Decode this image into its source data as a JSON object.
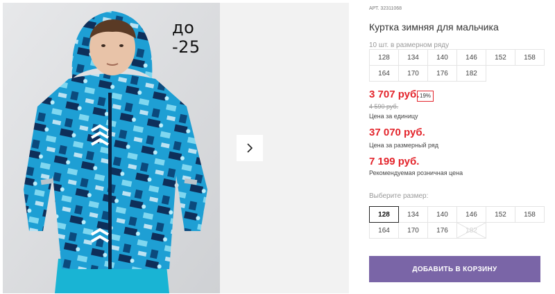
{
  "gallery": {
    "promo_badge": "до -25",
    "next_icon": "chevron-right-icon"
  },
  "product": {
    "sku_label": "АРТ.",
    "sku_value": "32311068",
    "title": "Куртка зимняя для мальчика",
    "row_note": "10 шт. в размерном ряду",
    "range_sizes": [
      "128",
      "134",
      "140",
      "146",
      "152",
      "158",
      "164",
      "170",
      "176",
      "182"
    ]
  },
  "prices": {
    "unit_price": "3 707 руб.",
    "discount": "19%",
    "old_price": "4 590 руб.",
    "unit_caption": "Цена за единицу",
    "range_price": "37 070 руб.",
    "range_caption": "Цена за размерный ряд",
    "retail_price": "7 199 руб.",
    "retail_caption": "Рекомендуемая розничная цена"
  },
  "size_picker": {
    "label": "Выберите размер:",
    "sizes": [
      {
        "label": "128",
        "state": "active"
      },
      {
        "label": "134",
        "state": "available"
      },
      {
        "label": "140",
        "state": "available"
      },
      {
        "label": "146",
        "state": "available"
      },
      {
        "label": "152",
        "state": "available"
      },
      {
        "label": "158",
        "state": "available"
      },
      {
        "label": "164",
        "state": "available"
      },
      {
        "label": "170",
        "state": "available"
      },
      {
        "label": "176",
        "state": "available"
      },
      {
        "label": "182",
        "state": "disabled"
      }
    ]
  },
  "cart": {
    "button_label": "ДОБАВИТЬ В КОРЗИНУ"
  },
  "colors": {
    "accent": "#7a65a7",
    "price_red": "#e3242b",
    "jacket_blue": "#1e9fd4",
    "jacket_navy": "#0e2f5a"
  }
}
